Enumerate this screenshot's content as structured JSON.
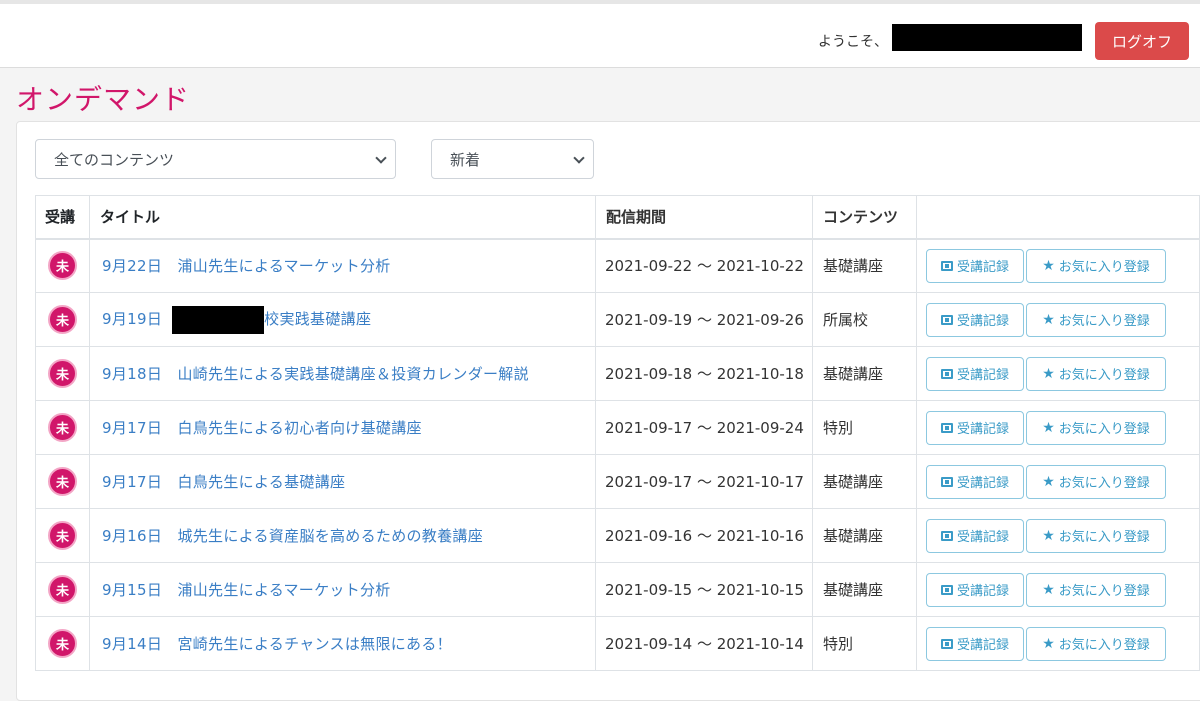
{
  "header": {
    "welcome": "ようこそ、",
    "logoff_label": "ログオフ"
  },
  "page": {
    "title": "オンデマンド"
  },
  "filters": {
    "content_select": "全てのコンテンツ",
    "sort_select": "新着"
  },
  "table": {
    "headers": {
      "status": "受講",
      "title": "タイトル",
      "period": "配信期間",
      "category": "コンテンツ"
    },
    "record_label": "受講記録",
    "favorite_label": "お気に入り登録",
    "rows": [
      {
        "status": "未",
        "date": "9月22日",
        "title": "浦山先生によるマーケット分析",
        "period": "2021-09-22 ～ 2021-10-22",
        "category": "基礎講座"
      },
      {
        "status": "未",
        "date": "9月19日",
        "title": "校実践基礎講座",
        "period": "2021-09-19 ～ 2021-09-26",
        "category": "所属校",
        "redacted": true
      },
      {
        "status": "未",
        "date": "9月18日",
        "title": "山崎先生による実践基礎講座＆投資カレンダー解説",
        "period": "2021-09-18 ～ 2021-10-18",
        "category": "基礎講座"
      },
      {
        "status": "未",
        "date": "9月17日",
        "title": "白鳥先生による初心者向け基礎講座",
        "period": "2021-09-17 ～ 2021-09-24",
        "category": "特別"
      },
      {
        "status": "未",
        "date": "9月17日",
        "title": "白鳥先生による基礎講座",
        "period": "2021-09-17 ～ 2021-10-17",
        "category": "基礎講座"
      },
      {
        "status": "未",
        "date": "9月16日",
        "title": "城先生による資産脳を高めるための教養講座",
        "period": "2021-09-16 ～ 2021-10-16",
        "category": "基礎講座"
      },
      {
        "status": "未",
        "date": "9月15日",
        "title": "浦山先生によるマーケット分析",
        "period": "2021-09-15 ～ 2021-10-15",
        "category": "基礎講座"
      },
      {
        "status": "未",
        "date": "9月14日",
        "title": "宮崎先生によるチャンスは無限にある！",
        "period": "2021-09-14 ～ 2021-10-14",
        "category": "特別"
      }
    ]
  },
  "colors": {
    "brand_pink": "#d1166a",
    "logoff_red": "#db4a4a",
    "link_blue": "#3a7ec5",
    "outline_blue": "#3a9bc7"
  },
  "icons": {
    "record": "film-icon",
    "favorite": "star-icon",
    "select": "chevron-down-icon"
  }
}
